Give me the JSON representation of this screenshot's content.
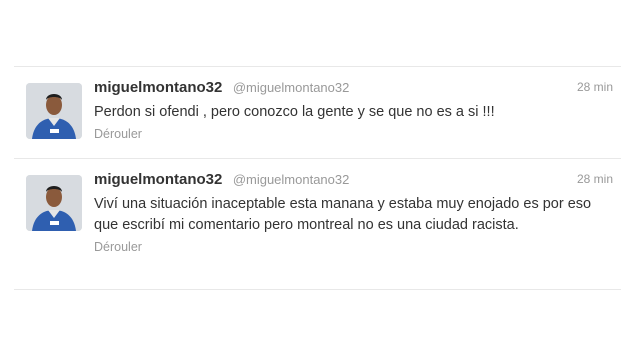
{
  "tweets": [
    {
      "fullname": "miguelmontano32",
      "screenname": "@miguelmontano32",
      "time": "28 min",
      "text": "Perdon si ofendi , pero conozco la gente y se que no es a si !!!",
      "action": "Dérouler"
    },
    {
      "fullname": "miguelmontano32",
      "screenname": "@miguelmontano32",
      "time": "28 min",
      "text": "Viví una situación inaceptable esta manana y estaba muy enojado es por eso que escribí mi comentario pero montreal no es una ciudad racista.",
      "action": "Dérouler"
    }
  ]
}
